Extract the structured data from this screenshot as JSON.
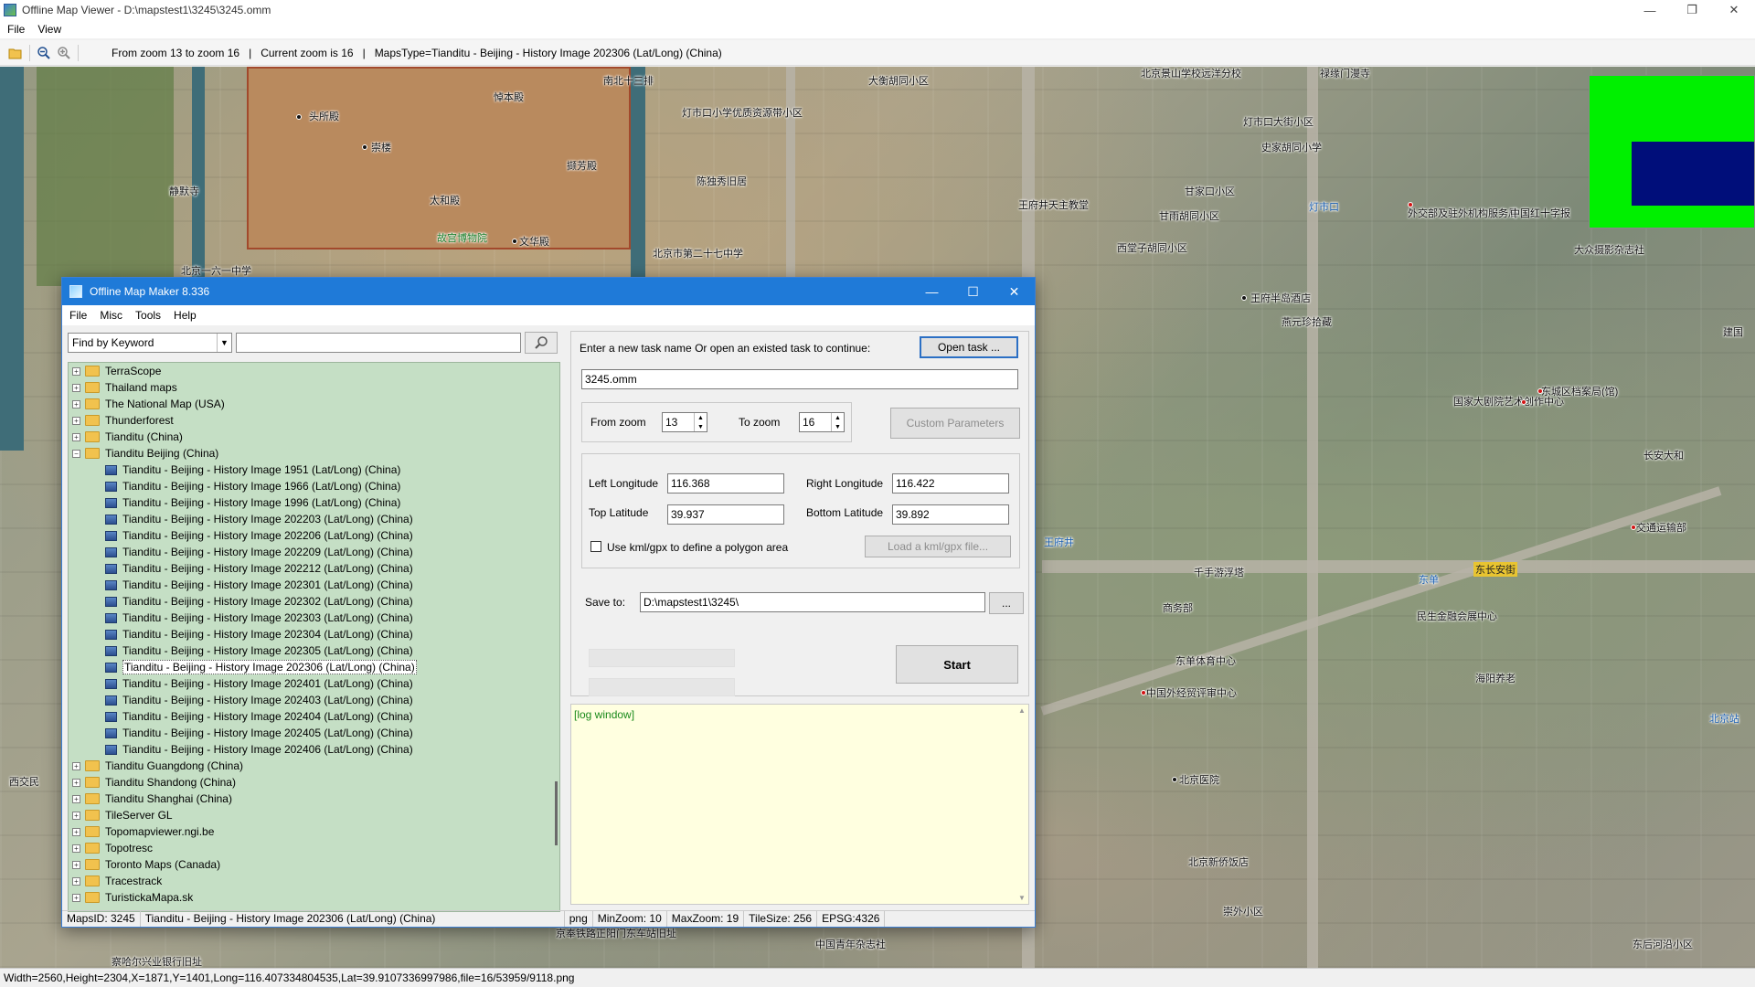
{
  "viewer": {
    "title": "Offline Map Viewer - D:\\mapstest1\\3245\\3245.omm",
    "menu": [
      "File",
      "View"
    ],
    "toolbar": {
      "zoom_range": "From zoom 13 to zoom 16",
      "sep": "|",
      "current_zoom": "Current zoom is 16",
      "maps_type": "MapsType=Tianditu - Beijing - History Image 202306 (Lat/Long) (China)"
    },
    "status": "Width=2560,Height=2304,X=1871,Y=1401,Long=116.407334804535,Lat=39.9107336997986,file=16/53959/9118.png"
  },
  "map_labels": [
    "北京景山学校远洋分校",
    "禄缘门漫寺",
    "南北十三排",
    "大衡胡同小区",
    "悼本殿",
    "头所殿",
    "崇楼",
    "文华殿",
    "灯市口小学优质资源带小区",
    "灯市口大街小区",
    "史家胡同小学",
    "撷芳殿",
    "陈独秀旧居",
    "太和殿",
    "静默寺",
    "故宫博物院",
    "北京市第二十七中学",
    "王府井天主教堂",
    "甘家口小区",
    "甘雨胡同小区",
    "西堂子胡同小区",
    "外交部及驻外机构服务局",
    "中国红十字报",
    "大众摄影杂志社",
    "灯市口",
    "王府半岛酒店",
    "燕元珍拾藏",
    "东城区档案局(馆)",
    "国家大剧院艺术创作中心",
    "长安大和",
    "交通运输部",
    "王府井",
    "千手游浮塔",
    "东单",
    "商务部",
    "民生金融会展中心",
    "东单体育中心",
    "海阳养老",
    "中国外经贸评审中心",
    "北京医院",
    "北京新侨饭店",
    "北京站",
    "崇外小区",
    "京奉铁路正阳门东车站旧址",
    "中国青年杂志社",
    "东后河沿小区",
    "察哈尔兴业银行旧址",
    "北京一六一中学",
    "西交民",
    "建国",
    "东长安街"
  ],
  "dialog": {
    "title": "Offline Map Maker 8.336",
    "menu": [
      "File",
      "Misc",
      "Tools",
      "Help"
    ],
    "find_by": "Find by Keyword",
    "keyword_value": "",
    "tree": [
      {
        "label": "TerraScope",
        "expanded": false
      },
      {
        "label": "Thailand maps",
        "expanded": false
      },
      {
        "label": "The National Map (USA)",
        "expanded": false
      },
      {
        "label": "Thunderforest",
        "expanded": false
      },
      {
        "label": "Tianditu (China)",
        "expanded": false
      },
      {
        "label": "Tianditu Beijing (China)",
        "expanded": true
      }
    ],
    "tree_children": [
      "Tianditu - Beijing - History Image 1951 (Lat/Long) (China)",
      "Tianditu - Beijing - History Image 1966 (Lat/Long) (China)",
      "Tianditu - Beijing - History Image 1996 (Lat/Long) (China)",
      "Tianditu - Beijing - History Image 202203 (Lat/Long) (China)",
      "Tianditu - Beijing - History Image 202206 (Lat/Long) (China)",
      "Tianditu - Beijing - History Image 202209 (Lat/Long) (China)",
      "Tianditu - Beijing - History Image 202212 (Lat/Long) (China)",
      "Tianditu - Beijing - History Image 202301 (Lat/Long) (China)",
      "Tianditu - Beijing - History Image 202302 (Lat/Long) (China)",
      "Tianditu - Beijing - History Image 202303 (Lat/Long) (China)",
      "Tianditu - Beijing - History Image 202304 (Lat/Long) (China)",
      "Tianditu - Beijing - History Image 202305 (Lat/Long) (China)",
      "Tianditu - Beijing - History Image 202306 (Lat/Long) (China)",
      "Tianditu - Beijing - History Image 202401 (Lat/Long) (China)",
      "Tianditu - Beijing - History Image 202403 (Lat/Long) (China)",
      "Tianditu - Beijing - History Image 202404 (Lat/Long) (China)",
      "Tianditu - Beijing - History Image 202405 (Lat/Long) (China)",
      "Tianditu - Beijing - History Image 202406 (Lat/Long) (China)"
    ],
    "selected_child_index": 12,
    "tree_after": [
      "Tianditu Guangdong (China)",
      "Tianditu Shandong (China)",
      "Tianditu Shanghai (China)",
      "TileServer GL",
      "Topomapviewer.ngi.be",
      "Topotresc",
      "Toronto Maps (Canada)",
      "Tracestrack",
      "TuristickaMapa.sk"
    ],
    "task_prompt": "Enter a new task name Or open an existed task to continue:",
    "open_task": "Open task ...",
    "task_name": "3245.omm",
    "from_zoom_label": "From zoom",
    "from_zoom": "13",
    "to_zoom_label": "To zoom",
    "to_zoom": "16",
    "custom_params": "Custom Parameters",
    "left_lon_label": "Left Longitude",
    "left_lon": "116.368",
    "right_lon_label": "Right Longitude",
    "right_lon": "116.422",
    "top_lat_label": "Top Latitude",
    "top_lat": "39.937",
    "bottom_lat_label": "Bottom Latitude",
    "bottom_lat": "39.892",
    "kml_label": "Use kml/gpx to define a polygon area",
    "kml_checked": false,
    "load_kml": "Load a kml/gpx file...",
    "save_to_label": "Save to:",
    "save_to": "D:\\mapstest1\\3245\\",
    "browse": "...",
    "start": "Start",
    "log": "[log window]",
    "status": {
      "maps_id": "MapsID: 3245",
      "maps_name": "Tianditu - Beijing - History Image 202306 (Lat/Long) (China)",
      "format": "png",
      "min_zoom": "MinZoom: 10",
      "max_zoom": "MaxZoom: 19",
      "tile_size": "TileSize: 256",
      "epsg": "EPSG:4326"
    }
  }
}
